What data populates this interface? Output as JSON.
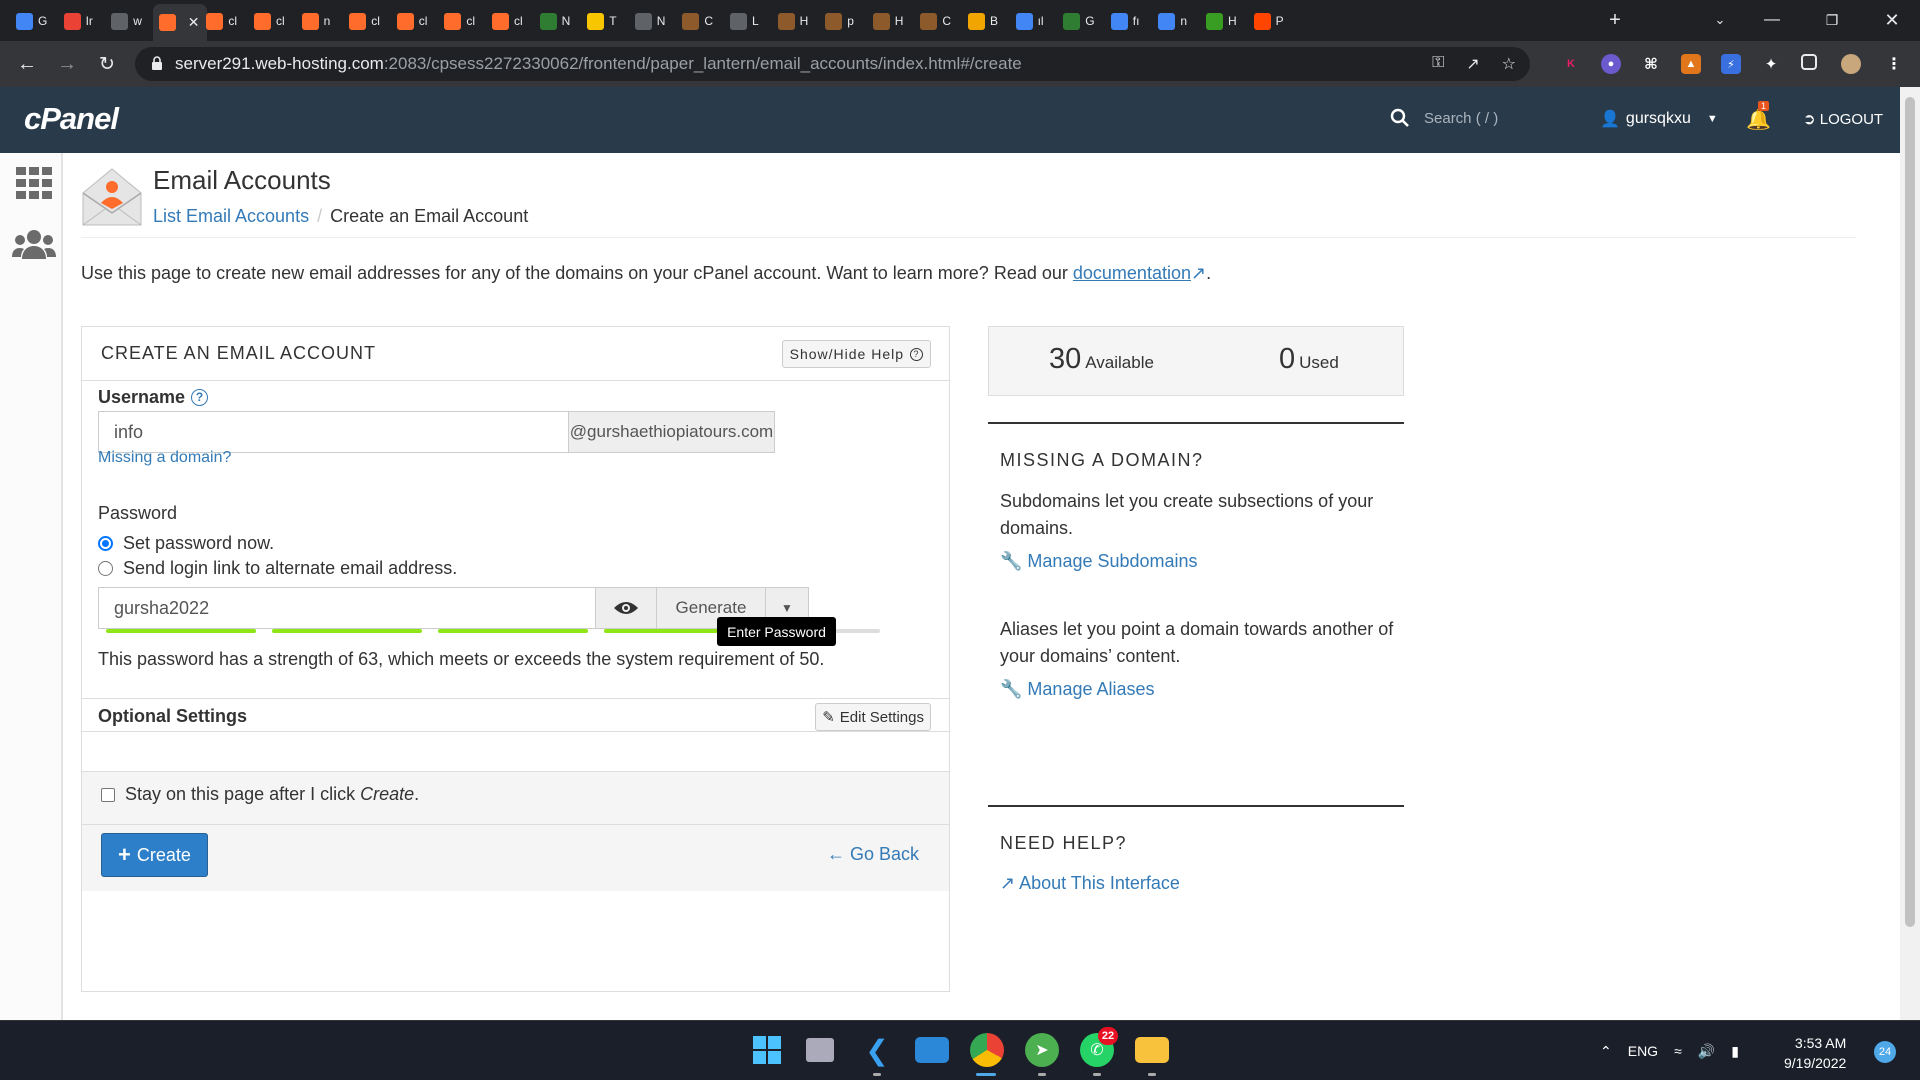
{
  "browser": {
    "tabs": [
      {
        "label": "G",
        "icon": "docs-icon",
        "color": "#4285f4"
      },
      {
        "label": "Ir",
        "icon": "gmail-icon",
        "color": "#ea4335"
      },
      {
        "label": "w",
        "icon": "globe-icon",
        "color": "#5f6368"
      },
      {
        "label": "",
        "icon": "cpanel-icon",
        "color": "#ff6c2c",
        "active": true
      },
      {
        "label": "cl",
        "icon": "cpanel-icon",
        "color": "#ff6c2c"
      },
      {
        "label": "cl",
        "icon": "cpanel-icon",
        "color": "#ff6c2c"
      },
      {
        "label": "n",
        "icon": "cpanel-icon",
        "color": "#ff6c2c"
      },
      {
        "label": "cl",
        "icon": "cpanel-icon",
        "color": "#ff6c2c"
      },
      {
        "label": "cl",
        "icon": "cpanel-icon",
        "color": "#ff6c2c"
      },
      {
        "label": "cl",
        "icon": "cpanel-icon",
        "color": "#ff6c2c"
      },
      {
        "label": "cl",
        "icon": "cpanel-icon",
        "color": "#ff6c2c"
      },
      {
        "label": "N",
        "icon": "tree-icon",
        "color": "#2e7d32"
      },
      {
        "label": "T",
        "icon": "s-coin-icon",
        "color": "#f7c600"
      },
      {
        "label": "N",
        "icon": "github-icon",
        "color": "#5f6368"
      },
      {
        "label": "C",
        "icon": "scroll-icon",
        "color": "#8d5b2b"
      },
      {
        "label": "L",
        "icon": "info-icon",
        "color": "#5f6368"
      },
      {
        "label": "H",
        "icon": "scroll-icon",
        "color": "#8d5b2b"
      },
      {
        "label": "p",
        "icon": "scroll-icon",
        "color": "#8d5b2b"
      },
      {
        "label": "H",
        "icon": "scroll-icon",
        "color": "#8d5b2b"
      },
      {
        "label": "C",
        "icon": "scroll-icon",
        "color": "#8d5b2b"
      },
      {
        "label": "B",
        "icon": "hex-icon",
        "color": "#f0a500"
      },
      {
        "label": "ıl",
        "icon": "google-icon",
        "color": "#4285f4"
      },
      {
        "label": "G",
        "icon": "tree-icon",
        "color": "#2e7d32"
      },
      {
        "label": "fı",
        "icon": "google-icon",
        "color": "#4285f4"
      },
      {
        "label": "n",
        "icon": "google-icon",
        "color": "#4285f4"
      },
      {
        "label": "H",
        "icon": "w-icon",
        "color": "#3a9d23"
      },
      {
        "label": "P",
        "icon": "reddit-icon",
        "color": "#ff4500"
      }
    ],
    "new_tab": "+",
    "url_host": "server291.web-hosting.com",
    "url_path": ":2083/cpsess2272330062/frontend/paper_lantern/email_accounts/index.html#/create"
  },
  "cpanel": {
    "logo": "cPanel",
    "search_placeholder": "Search ( / )",
    "username": "gursqkxu",
    "notification_count": "1",
    "logout": "LOGOUT"
  },
  "page": {
    "title": "Email Accounts",
    "breadcrumb_link": "List Email Accounts",
    "breadcrumb_current": "Create an Email Account",
    "intro": "Use this page to create new email addresses for any of the domains on your cPanel account. Want to learn more? Read our",
    "intro_link": "documentation",
    "intro_end": "."
  },
  "form": {
    "heading": "CREATE AN EMAIL ACCOUNT",
    "help_button": "Show/Hide Help",
    "username_label": "Username",
    "username_value": "info",
    "domain": "@gurshaethiopiatours.com",
    "missing_domain_link": "Missing a domain?",
    "password_label": "Password",
    "radio_set_now": "Set password now.",
    "radio_send_link": "Send login link to alternate email address.",
    "password_value": "gursha2022",
    "generate": "Generate",
    "tooltip": "Enter Password",
    "strength_text": "This password has a strength of 63, which meets or exceeds the system requirement of 50.",
    "strength_value": 63,
    "strength_color": "#8ee617",
    "optional_label": "Optional Settings",
    "edit_settings": "Edit Settings",
    "stay_text_pre": "Stay on this page after I click",
    "stay_text_em": "Create",
    "stay_text_post": ".",
    "create_button": "Create",
    "go_back": "Go Back"
  },
  "sidebar_right": {
    "available_count": "30",
    "available_label": "Available",
    "used_count": "0",
    "used_label": "Used",
    "missing_heading": "MISSING A DOMAIN?",
    "subdomains_text": "Subdomains let you create subsections of your domains.",
    "manage_subdomains": "Manage Subdomains",
    "aliases_text": "Aliases let you point a domain towards another of your domains’ content.",
    "manage_aliases": "Manage Aliases",
    "help_heading": "NEED HELP?",
    "about_link": "About This Interface"
  },
  "taskbar": {
    "whatsapp_badge": "22",
    "language": "ENG",
    "time": "3:53 AM",
    "date": "9/19/2022",
    "notifications": "24"
  },
  "colors": {
    "cpanel_header": "#293a4a",
    "link": "#337ab7",
    "primary_button": "#2d7fc9",
    "accent_orange": "#ff6c2c"
  }
}
